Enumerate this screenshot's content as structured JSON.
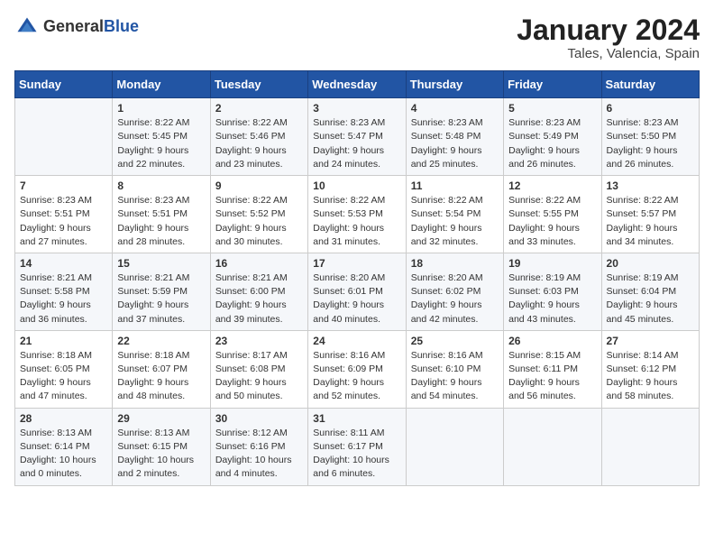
{
  "header": {
    "logo_general": "General",
    "logo_blue": "Blue",
    "month_title": "January 2024",
    "location": "Tales, Valencia, Spain"
  },
  "days_of_week": [
    "Sunday",
    "Monday",
    "Tuesday",
    "Wednesday",
    "Thursday",
    "Friday",
    "Saturday"
  ],
  "weeks": [
    [
      {
        "day": "",
        "sunrise": "",
        "sunset": "",
        "daylight": ""
      },
      {
        "day": "1",
        "sunrise": "Sunrise: 8:22 AM",
        "sunset": "Sunset: 5:45 PM",
        "daylight": "Daylight: 9 hours and 22 minutes."
      },
      {
        "day": "2",
        "sunrise": "Sunrise: 8:22 AM",
        "sunset": "Sunset: 5:46 PM",
        "daylight": "Daylight: 9 hours and 23 minutes."
      },
      {
        "day": "3",
        "sunrise": "Sunrise: 8:23 AM",
        "sunset": "Sunset: 5:47 PM",
        "daylight": "Daylight: 9 hours and 24 minutes."
      },
      {
        "day": "4",
        "sunrise": "Sunrise: 8:23 AM",
        "sunset": "Sunset: 5:48 PM",
        "daylight": "Daylight: 9 hours and 25 minutes."
      },
      {
        "day": "5",
        "sunrise": "Sunrise: 8:23 AM",
        "sunset": "Sunset: 5:49 PM",
        "daylight": "Daylight: 9 hours and 26 minutes."
      },
      {
        "day": "6",
        "sunrise": "Sunrise: 8:23 AM",
        "sunset": "Sunset: 5:50 PM",
        "daylight": "Daylight: 9 hours and 26 minutes."
      }
    ],
    [
      {
        "day": "7",
        "sunrise": "Sunrise: 8:23 AM",
        "sunset": "Sunset: 5:51 PM",
        "daylight": "Daylight: 9 hours and 27 minutes."
      },
      {
        "day": "8",
        "sunrise": "Sunrise: 8:23 AM",
        "sunset": "Sunset: 5:51 PM",
        "daylight": "Daylight: 9 hours and 28 minutes."
      },
      {
        "day": "9",
        "sunrise": "Sunrise: 8:22 AM",
        "sunset": "Sunset: 5:52 PM",
        "daylight": "Daylight: 9 hours and 30 minutes."
      },
      {
        "day": "10",
        "sunrise": "Sunrise: 8:22 AM",
        "sunset": "Sunset: 5:53 PM",
        "daylight": "Daylight: 9 hours and 31 minutes."
      },
      {
        "day": "11",
        "sunrise": "Sunrise: 8:22 AM",
        "sunset": "Sunset: 5:54 PM",
        "daylight": "Daylight: 9 hours and 32 minutes."
      },
      {
        "day": "12",
        "sunrise": "Sunrise: 8:22 AM",
        "sunset": "Sunset: 5:55 PM",
        "daylight": "Daylight: 9 hours and 33 minutes."
      },
      {
        "day": "13",
        "sunrise": "Sunrise: 8:22 AM",
        "sunset": "Sunset: 5:57 PM",
        "daylight": "Daylight: 9 hours and 34 minutes."
      }
    ],
    [
      {
        "day": "14",
        "sunrise": "Sunrise: 8:21 AM",
        "sunset": "Sunset: 5:58 PM",
        "daylight": "Daylight: 9 hours and 36 minutes."
      },
      {
        "day": "15",
        "sunrise": "Sunrise: 8:21 AM",
        "sunset": "Sunset: 5:59 PM",
        "daylight": "Daylight: 9 hours and 37 minutes."
      },
      {
        "day": "16",
        "sunrise": "Sunrise: 8:21 AM",
        "sunset": "Sunset: 6:00 PM",
        "daylight": "Daylight: 9 hours and 39 minutes."
      },
      {
        "day": "17",
        "sunrise": "Sunrise: 8:20 AM",
        "sunset": "Sunset: 6:01 PM",
        "daylight": "Daylight: 9 hours and 40 minutes."
      },
      {
        "day": "18",
        "sunrise": "Sunrise: 8:20 AM",
        "sunset": "Sunset: 6:02 PM",
        "daylight": "Daylight: 9 hours and 42 minutes."
      },
      {
        "day": "19",
        "sunrise": "Sunrise: 8:19 AM",
        "sunset": "Sunset: 6:03 PM",
        "daylight": "Daylight: 9 hours and 43 minutes."
      },
      {
        "day": "20",
        "sunrise": "Sunrise: 8:19 AM",
        "sunset": "Sunset: 6:04 PM",
        "daylight": "Daylight: 9 hours and 45 minutes."
      }
    ],
    [
      {
        "day": "21",
        "sunrise": "Sunrise: 8:18 AM",
        "sunset": "Sunset: 6:05 PM",
        "daylight": "Daylight: 9 hours and 47 minutes."
      },
      {
        "day": "22",
        "sunrise": "Sunrise: 8:18 AM",
        "sunset": "Sunset: 6:07 PM",
        "daylight": "Daylight: 9 hours and 48 minutes."
      },
      {
        "day": "23",
        "sunrise": "Sunrise: 8:17 AM",
        "sunset": "Sunset: 6:08 PM",
        "daylight": "Daylight: 9 hours and 50 minutes."
      },
      {
        "day": "24",
        "sunrise": "Sunrise: 8:16 AM",
        "sunset": "Sunset: 6:09 PM",
        "daylight": "Daylight: 9 hours and 52 minutes."
      },
      {
        "day": "25",
        "sunrise": "Sunrise: 8:16 AM",
        "sunset": "Sunset: 6:10 PM",
        "daylight": "Daylight: 9 hours and 54 minutes."
      },
      {
        "day": "26",
        "sunrise": "Sunrise: 8:15 AM",
        "sunset": "Sunset: 6:11 PM",
        "daylight": "Daylight: 9 hours and 56 minutes."
      },
      {
        "day": "27",
        "sunrise": "Sunrise: 8:14 AM",
        "sunset": "Sunset: 6:12 PM",
        "daylight": "Daylight: 9 hours and 58 minutes."
      }
    ],
    [
      {
        "day": "28",
        "sunrise": "Sunrise: 8:13 AM",
        "sunset": "Sunset: 6:14 PM",
        "daylight": "Daylight: 10 hours and 0 minutes."
      },
      {
        "day": "29",
        "sunrise": "Sunrise: 8:13 AM",
        "sunset": "Sunset: 6:15 PM",
        "daylight": "Daylight: 10 hours and 2 minutes."
      },
      {
        "day": "30",
        "sunrise": "Sunrise: 8:12 AM",
        "sunset": "Sunset: 6:16 PM",
        "daylight": "Daylight: 10 hours and 4 minutes."
      },
      {
        "day": "31",
        "sunrise": "Sunrise: 8:11 AM",
        "sunset": "Sunset: 6:17 PM",
        "daylight": "Daylight: 10 hours and 6 minutes."
      },
      {
        "day": "",
        "sunrise": "",
        "sunset": "",
        "daylight": ""
      },
      {
        "day": "",
        "sunrise": "",
        "sunset": "",
        "daylight": ""
      },
      {
        "day": "",
        "sunrise": "",
        "sunset": "",
        "daylight": ""
      }
    ]
  ]
}
